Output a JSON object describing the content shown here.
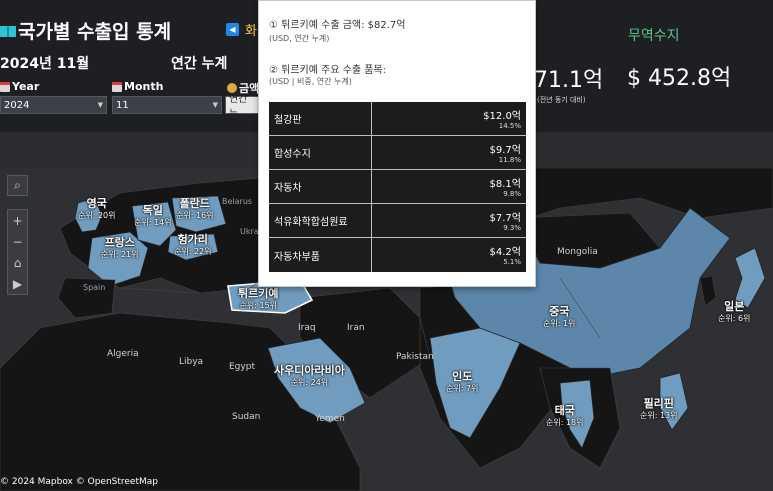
{
  "header": {
    "title": "국가별 수출입 통계",
    "nav_hint": "화",
    "trade_label": "무역수지",
    "date": "2024년 11월",
    "cumulative": "연간 누계",
    "kpi_import_partial": "71.1억",
    "kpi_import_sub": "(전년 동기 대비)",
    "kpi_balance": "$ 452.8억"
  },
  "filters": {
    "year_label": "Year",
    "year_value": "2024",
    "month_label": "Month",
    "month_value": "11",
    "amount_label": "금액",
    "amount_value": "연간 누"
  },
  "tooltip": {
    "line1": "① 튀르키예 수출 금액: $82.7억",
    "line1_sub": "(USD,  연간 누계)",
    "line2": "② 튀르키예 주요 수출 품목:",
    "line2_sub": "(USD | 비중,  연간 누계)",
    "items": [
      {
        "name": "철강판",
        "value": "$12.0억",
        "share": "14.5%"
      },
      {
        "name": "합성수지",
        "value": "$9.7억",
        "share": "11.8%"
      },
      {
        "name": "자동차",
        "value": "$8.1억",
        "share": "9.8%"
      },
      {
        "name": "석유화학합섬원료",
        "value": "$7.7억",
        "share": "9.3%"
      },
      {
        "name": "자동차부품",
        "value": "$4.2억",
        "share": "5.1%"
      }
    ]
  },
  "map": {
    "countries": [
      {
        "name": "영국",
        "rank": "순위: 20위"
      },
      {
        "name": "독일",
        "rank": "순위: 14위"
      },
      {
        "name": "폴란드",
        "rank": "순위: 16위"
      },
      {
        "name": "프랑스",
        "rank": "순위: 21위"
      },
      {
        "name": "헝가리",
        "rank": "순위: 22위"
      },
      {
        "name": "튀르키예",
        "rank": "순위: 15위"
      },
      {
        "name": "사우디아라비아",
        "rank": "순위: 24위"
      },
      {
        "name": "인도",
        "rank": "순위: 7위"
      },
      {
        "name": "중국",
        "rank": "순위: 1위"
      },
      {
        "name": "일본",
        "rank": "순위: 6위"
      },
      {
        "name": "태국",
        "rank": "순위: 18위"
      },
      {
        "name": "필리핀",
        "rank": "순위: 13위"
      }
    ],
    "geo_labels": {
      "belarus": "Belarus",
      "ukraine": "Ukra",
      "spain": "Spain",
      "algeria": "Algeria",
      "libya": "Libya",
      "egypt": "Egypt",
      "sudan": "Sudan",
      "iraq": "Iraq",
      "iran": "Iran",
      "pakistan": "Pakistan",
      "yemen": "Yemen",
      "mongolia": "Mongolia"
    },
    "attribution": "© 2024 Mapbox  © OpenStreetMap"
  },
  "colors": {
    "highlight_country": "#6f9cbf",
    "china": "#5c87ab",
    "land": "#151515",
    "sea": "#2f3034",
    "trade_balance": "#5ec48a",
    "nav_hint": "#ffd23c"
  }
}
